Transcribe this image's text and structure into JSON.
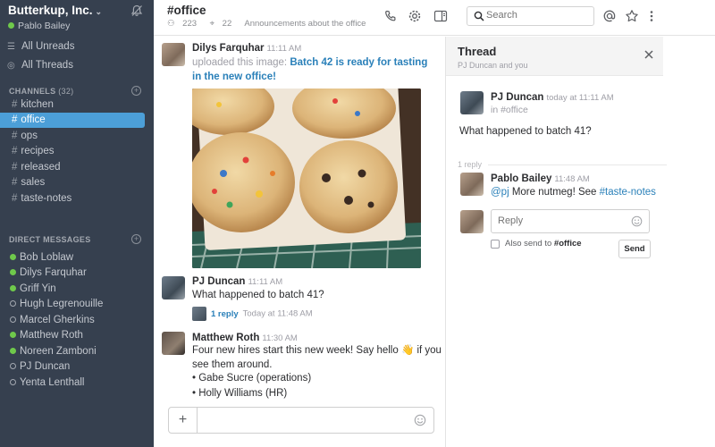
{
  "sidebar": {
    "team_name": "Butterkup, Inc.",
    "team_caret": "⌄",
    "user_name": "Pablo Bailey",
    "all_unreads": "All Unreads",
    "all_threads": "All Threads",
    "channels_label": "CHANNELS",
    "channels_count": "(32)",
    "channels": [
      "kitchen",
      "office",
      "ops",
      "recipes",
      "released",
      "sales",
      "taste-notes"
    ],
    "dm_label": "DIRECT MESSAGES",
    "dms": [
      {
        "name": "Bob Loblaw",
        "online": true
      },
      {
        "name": "Dilys Farquhar",
        "online": true
      },
      {
        "name": "Griff Yin",
        "online": true
      },
      {
        "name": "Hugh Legrenouille",
        "online": false
      },
      {
        "name": "Marcel Gherkins",
        "online": false
      },
      {
        "name": "Matthew Roth",
        "online": true
      },
      {
        "name": "Noreen Zamboni",
        "online": true
      },
      {
        "name": "PJ Duncan",
        "online": false
      },
      {
        "name": "Yenta Lenthall",
        "online": false
      }
    ]
  },
  "header": {
    "channel": "#office",
    "members": "223",
    "pins": "22",
    "purpose": "Announcements about the office",
    "search_placeholder": "Search"
  },
  "messages": {
    "m1": {
      "author": "Dilys Farquhar",
      "time": "11:11 AM",
      "prefix": "uploaded this image: ",
      "link": "Batch 42 is ready for tasting in the new office!"
    },
    "m2": {
      "author": "PJ Duncan",
      "time": "11:11 AM",
      "text": "What happened to batch 41?",
      "reply_count": "1 reply",
      "reply_time": "Today at 11:48 AM"
    },
    "m3": {
      "author": "Matthew Roth",
      "time": "11:30 AM",
      "line1_a": "Four new hires start this new week! Say hello ",
      "wave": "👋",
      "line1_b": " if you",
      "line2": "see them around.",
      "bullets": [
        "• Gabe Sucre (operations)",
        "• Holly Williams (HR)"
      ]
    }
  },
  "thread": {
    "title": "Thread",
    "subtitle": "PJ Duncan and you",
    "parent_author": "PJ Duncan",
    "parent_time": "today at 11:11 AM",
    "parent_channel": "in #office",
    "parent_text": "What happened to batch 41?",
    "reply_count": "1 reply",
    "reply_author": "Pablo Bailey",
    "reply_time": "11:48 AM",
    "reply_mention": "@pj",
    "reply_text": " More nutmeg! See ",
    "reply_channel": "#taste-notes",
    "reply_placeholder": "Reply",
    "also_send_prefix": "Also send to ",
    "also_send_channel": "#office",
    "send_label": "Send"
  },
  "colors": {
    "sidebar_bg": "#36404f",
    "active_channel": "#4c9fd8",
    "link": "#2a80b9",
    "presence": "#6fc94b"
  }
}
